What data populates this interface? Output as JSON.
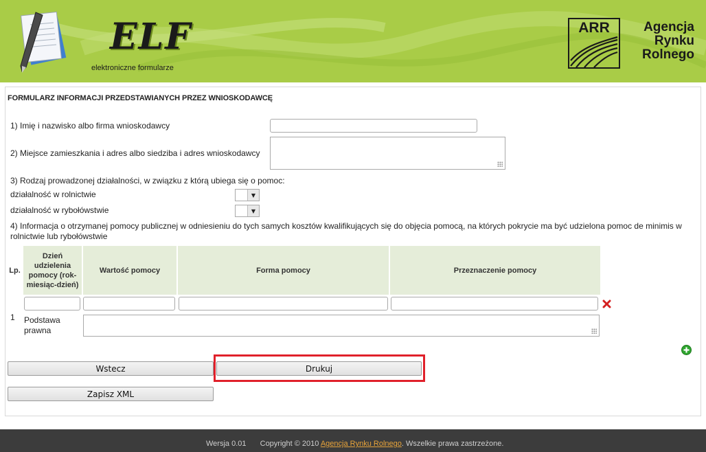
{
  "header": {
    "app_title": "ELF",
    "app_subtitle": "elektroniczne formularze",
    "agency_abbrev": "ARR",
    "agency_name": "Agencja\nRynku\nRolnego",
    "brand_color": "#a9cc47"
  },
  "form": {
    "title": "FORMULARZ INFORMACJI PRZEDSTAWIANYCH PRZEZ WNIOSKODAWCĘ",
    "q1_label": "1) Imię i nazwisko albo firma wnioskodawcy",
    "q1_value": "",
    "q2_label": "2) Miejsce zamieszkania i adres albo siedziba i adres wnioskodawcy",
    "q2_value": "",
    "q3_label": "3) Rodzaj prowadzonej działalności, w związku z którą ubiega się o pomoc:",
    "q3_opt1_label": "działalność w rolnictwie",
    "q3_opt1_value": "",
    "q3_opt2_label": "działalność w rybołówstwie",
    "q3_opt2_value": "",
    "q4_label": "4) Informacja o otrzymanej pomocy publicznej w odniesieniu do tych samych kosztów kwalifikujących się do objęcia pomocą, na których pokrycie ma być udzielona pomoc de minimis w rolnictwie lub rybołówstwie"
  },
  "table": {
    "headers": {
      "lp": "Lp.",
      "date": "Dzień udzielenia pomocy (rok-miesiąc-dzień)",
      "value": "Wartość pomocy",
      "form": "Forma pomocy",
      "purpose": "Przeznaczenie pomocy"
    },
    "rows": [
      {
        "lp": "1",
        "date": "",
        "value": "",
        "form": "",
        "purpose": "",
        "legal_basis_label": "Podstawa prawna",
        "legal_basis_value": ""
      }
    ]
  },
  "buttons": {
    "back": "Wstecz",
    "print": "Drukuj",
    "save_xml": "Zapisz XML"
  },
  "icons": {
    "delete_row": "close-icon",
    "add_row": "plus-icon"
  },
  "footer": {
    "version": "Wersja 0.01",
    "copyright_prefix": "Copyright © 2010",
    "link_text": "Agencja Rynku Rolnego",
    "copyright_suffix": ". Wszelkie prawa zastrzeżone."
  },
  "colors": {
    "table_header_bg": "#e5edd9",
    "highlight_border": "#e0202a",
    "footer_bg": "#3c3c3c",
    "footer_link": "#e8a43a"
  }
}
